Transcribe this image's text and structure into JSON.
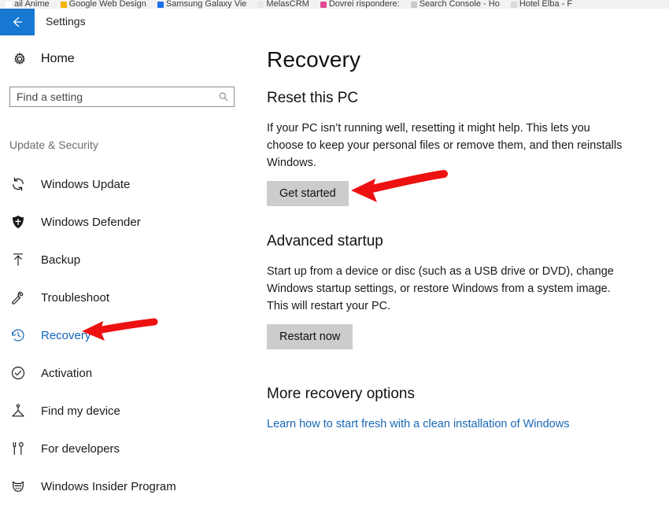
{
  "browser_bookmarks": {
    "items": [
      {
        "label": "ail Anime",
        "favicon_color": "#ffffff"
      },
      {
        "label": "Google Web Design",
        "favicon_color": "#f5b400"
      },
      {
        "label": "Samsung Galaxy Vie",
        "favicon_color": "#1a73e8"
      },
      {
        "label": "MelasCRM",
        "favicon_color": "#e8e8e8"
      },
      {
        "label": "Dovrei rispondere:",
        "favicon_color": "#e24a90"
      },
      {
        "label": "Search Console - Ho",
        "favicon_color": "#c9c9c9"
      },
      {
        "label": "Hotel Elba - F",
        "favicon_color": "#d9d9d9"
      }
    ]
  },
  "titlebar": {
    "back_icon": "arrow-left-icon",
    "title": "Settings",
    "back_color": "#1779d2"
  },
  "sidebar": {
    "home": {
      "icon": "gear-icon",
      "label": "Home"
    },
    "search": {
      "value": "",
      "placeholder": "Find a setting",
      "icon": "search-icon"
    },
    "group_title": "Update & Security",
    "items": [
      {
        "icon": "sync-icon",
        "label": "Windows Update",
        "selected": false
      },
      {
        "icon": "shield-icon",
        "label": "Windows Defender",
        "selected": false
      },
      {
        "icon": "upload-arrow-icon",
        "label": "Backup",
        "selected": false
      },
      {
        "icon": "wrench-icon",
        "label": "Troubleshoot",
        "selected": false
      },
      {
        "icon": "history-clock-icon",
        "label": "Recovery",
        "selected": true
      },
      {
        "icon": "check-circle-icon",
        "label": "Activation",
        "selected": false
      },
      {
        "icon": "find-device-icon",
        "label": "Find my device",
        "selected": false
      },
      {
        "icon": "tools-icon",
        "label": "For developers",
        "selected": false
      },
      {
        "icon": "ninjacat-icon",
        "label": "Windows Insider Program",
        "selected": false
      }
    ],
    "selected_color": "#1062b5"
  },
  "main": {
    "page_title": "Recovery",
    "sections": [
      {
        "title": "Reset this PC",
        "body": "If your PC isn’t running well, resetting it might help. This lets you choose to keep your personal files or remove them, and then reinstalls Windows.",
        "button": "Get started"
      },
      {
        "title": "Advanced startup",
        "body": "Start up from a device or disc (such as a USB drive or DVD), change Windows startup settings, or restore Windows from a system image. This will restart your PC.",
        "button": "Restart now"
      }
    ],
    "more_options": {
      "title": "More recovery options",
      "link": "Learn how to start fresh with a clean installation of Windows"
    },
    "button_color": "#cccccc",
    "link_color": "#1768b5"
  },
  "annotations": {
    "color": "#ee1111",
    "arrows": [
      {
        "name": "arrow-pointing-to-recovery-nav",
        "target": "Recovery"
      },
      {
        "name": "arrow-pointing-to-get-started-button",
        "target": "Get started"
      }
    ]
  }
}
